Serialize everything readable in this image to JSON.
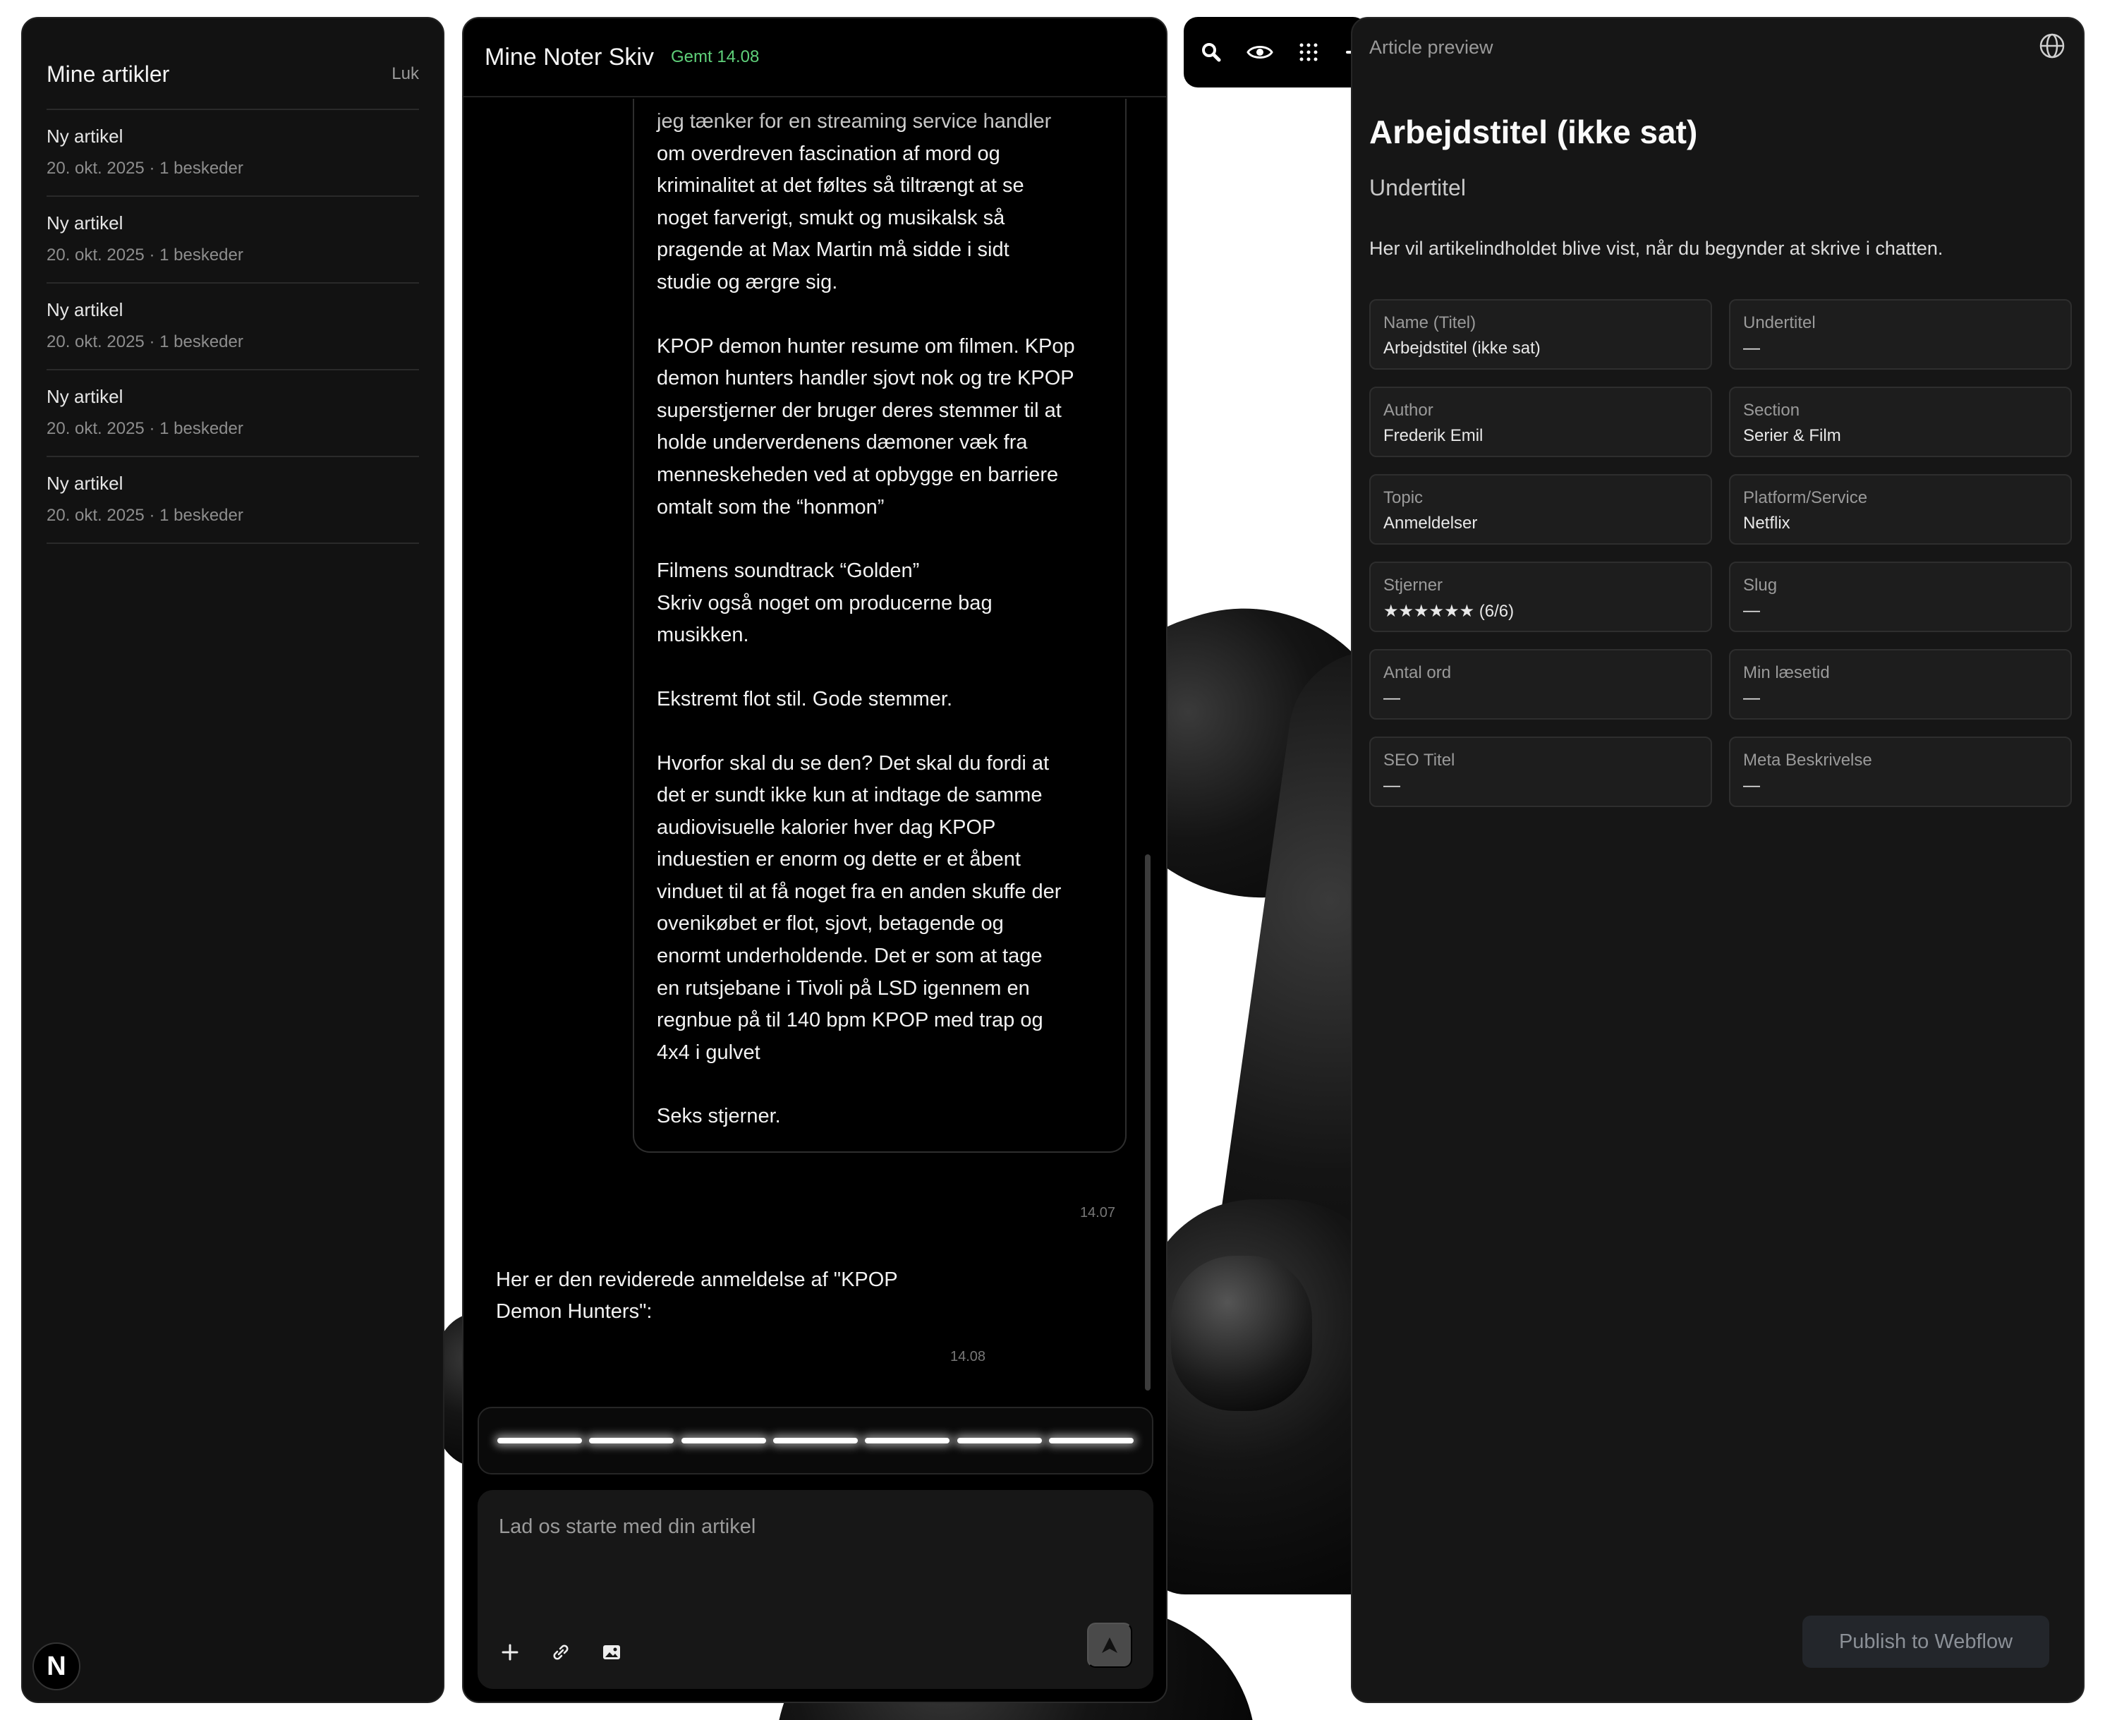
{
  "sidebar": {
    "title": "Mine artikler",
    "close_label": "Luk",
    "items": [
      {
        "title": "Ny artikel",
        "meta": "20. okt. 2025 · 1 beskeder"
      },
      {
        "title": "Ny artikel",
        "meta": "20. okt. 2025 · 1 beskeder"
      },
      {
        "title": "Ny artikel",
        "meta": "20. okt. 2025 · 1 beskeder"
      },
      {
        "title": "Ny artikel",
        "meta": "20. okt. 2025 · 1 beskeder"
      },
      {
        "title": "Ny artikel",
        "meta": "20. okt. 2025 · 1 beskeder"
      }
    ],
    "logo_letter": "N"
  },
  "chat": {
    "title": "Mine Noter Skiv",
    "saved": "Gemt 14.08",
    "user_message": {
      "paragraphs": [
        "jeg tænker for en streaming service handler\nom overdreven fascination af mord og\nkriminalitet at det føltes så tiltrængt at se\nnoget farverigt, smukt og musikalsk så\npragende at Max Martin må sidde i sidt\nstudie og ærgre sig.",
        "KPOP demon hunter resume om filmen. KPop\ndemon hunters handler sjovt nok og tre KPOP\nsuperstjerner der bruger deres stemmer til at\nholde underverdenens dæmoner væk fra\nmenneskeheden ved at opbygge en barriere\nomtalt som the “honmon”",
        "Filmens soundtrack “Golden”\nSkriv også noget om producerne bag\nmusikken.",
        "Ekstremt flot stil. Gode stemmer.",
        "Hvorfor skal du se den? Det skal du fordi at\ndet er sundt ikke kun at indtage de samme\naudiovisuelle kalorier hver dag KPOP\ninduestien er enorm og dette er et åbent\nvinduet til at få noget fra en anden skuffe der\novenikøbet er flot, sjovt, betagende og\nenormt underholdende. Det er som at tage\nen rutsjebane i Tivoli på LSD igennem en\nregnbue på til 140 bpm KPOP med trap og\n4x4 i gulvet",
        "Seks stjerner."
      ],
      "time": "14.07"
    },
    "bot_message": {
      "text": "Her er den reviderede anmeldelse af \"KPOP Demon Hunters\":",
      "time": "14.08"
    },
    "composer": {
      "placeholder": "Lad os starte med din artikel"
    }
  },
  "preview": {
    "label": "Article preview",
    "title": "Arbejdstitel (ikke sat)",
    "subtitle": "Undertitel",
    "body": "Her vil artikelindholdet blive vist, når du begynder at skrive i chatten.",
    "fields": [
      {
        "label": "Name (Titel)",
        "value": "Arbejdstitel (ikke sat)"
      },
      {
        "label": "Undertitel",
        "value": "—"
      },
      {
        "label": "Author",
        "value": "Frederik Emil"
      },
      {
        "label": "Section",
        "value": "Serier & Film"
      },
      {
        "label": "Topic",
        "value": "Anmeldelser"
      },
      {
        "label": "Platform/Service",
        "value": "Netflix"
      },
      {
        "label": "Stjerner",
        "value": "★★★★★★ (6/6)"
      },
      {
        "label": "Slug",
        "value": "—"
      },
      {
        "label": "Antal ord",
        "value": "—"
      },
      {
        "label": "Min læsetid",
        "value": "—"
      },
      {
        "label": "SEO Titel",
        "value": "—"
      },
      {
        "label": "Meta Beskrivelse",
        "value": "—"
      }
    ],
    "publish_label": "Publish to Webflow"
  },
  "colors": {
    "saved_green": "#5fd07a",
    "panel_bg": "#161616",
    "chat_bg": "#000000"
  }
}
